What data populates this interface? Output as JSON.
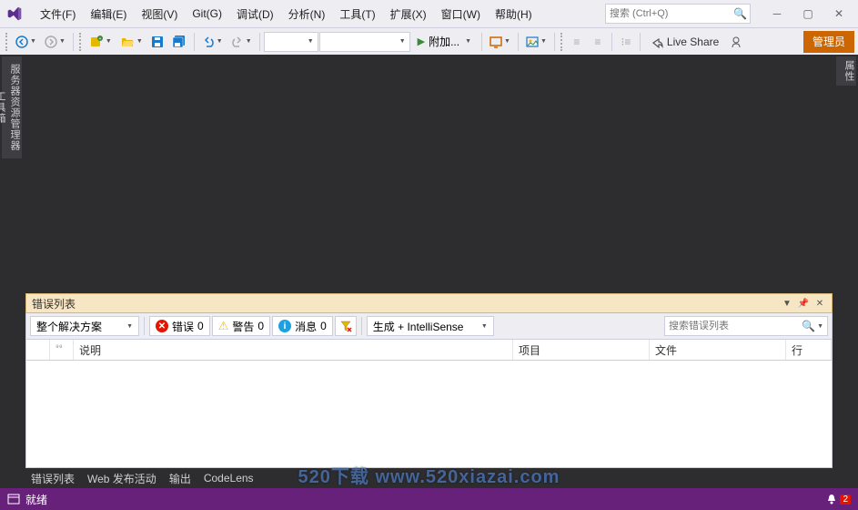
{
  "menu": {
    "file": "文件(F)",
    "edit": "编辑(E)",
    "view": "视图(V)",
    "git": "Git(G)",
    "debug": "调试(D)",
    "analyze": "分析(N)",
    "tools": "工具(T)",
    "extensions": "扩展(X)",
    "window": "窗口(W)",
    "help": "帮助(H)"
  },
  "search": {
    "placeholder": "搜索 (Ctrl+Q)"
  },
  "toolbar": {
    "attach": "附加...",
    "live_share": "Live Share",
    "admin": "管理员"
  },
  "side_left": {
    "tab1": "服务器资源管理器",
    "tab2": "工具箱"
  },
  "side_right": {
    "tab1": "属性"
  },
  "error_panel": {
    "title": "错误列表",
    "scope": "整个解决方案",
    "errors_label": "错误",
    "errors_count": "0",
    "warnings_label": "警告",
    "warnings_count": "0",
    "messages_label": "消息",
    "messages_count": "0",
    "build_filter": "生成 + IntelliSense",
    "search_placeholder": "搜索错误列表",
    "columns": {
      "code": "",
      "description": "说明",
      "project": "项目",
      "file": "文件",
      "line": "行"
    }
  },
  "bottom_tabs": {
    "errors": "错误列表",
    "webpub": "Web 发布活动",
    "output": "输出",
    "codelens": "CodeLens"
  },
  "status": {
    "ready": "就绪",
    "notif_count": "2"
  },
  "watermark": "520下载 www.520xiazai.com"
}
